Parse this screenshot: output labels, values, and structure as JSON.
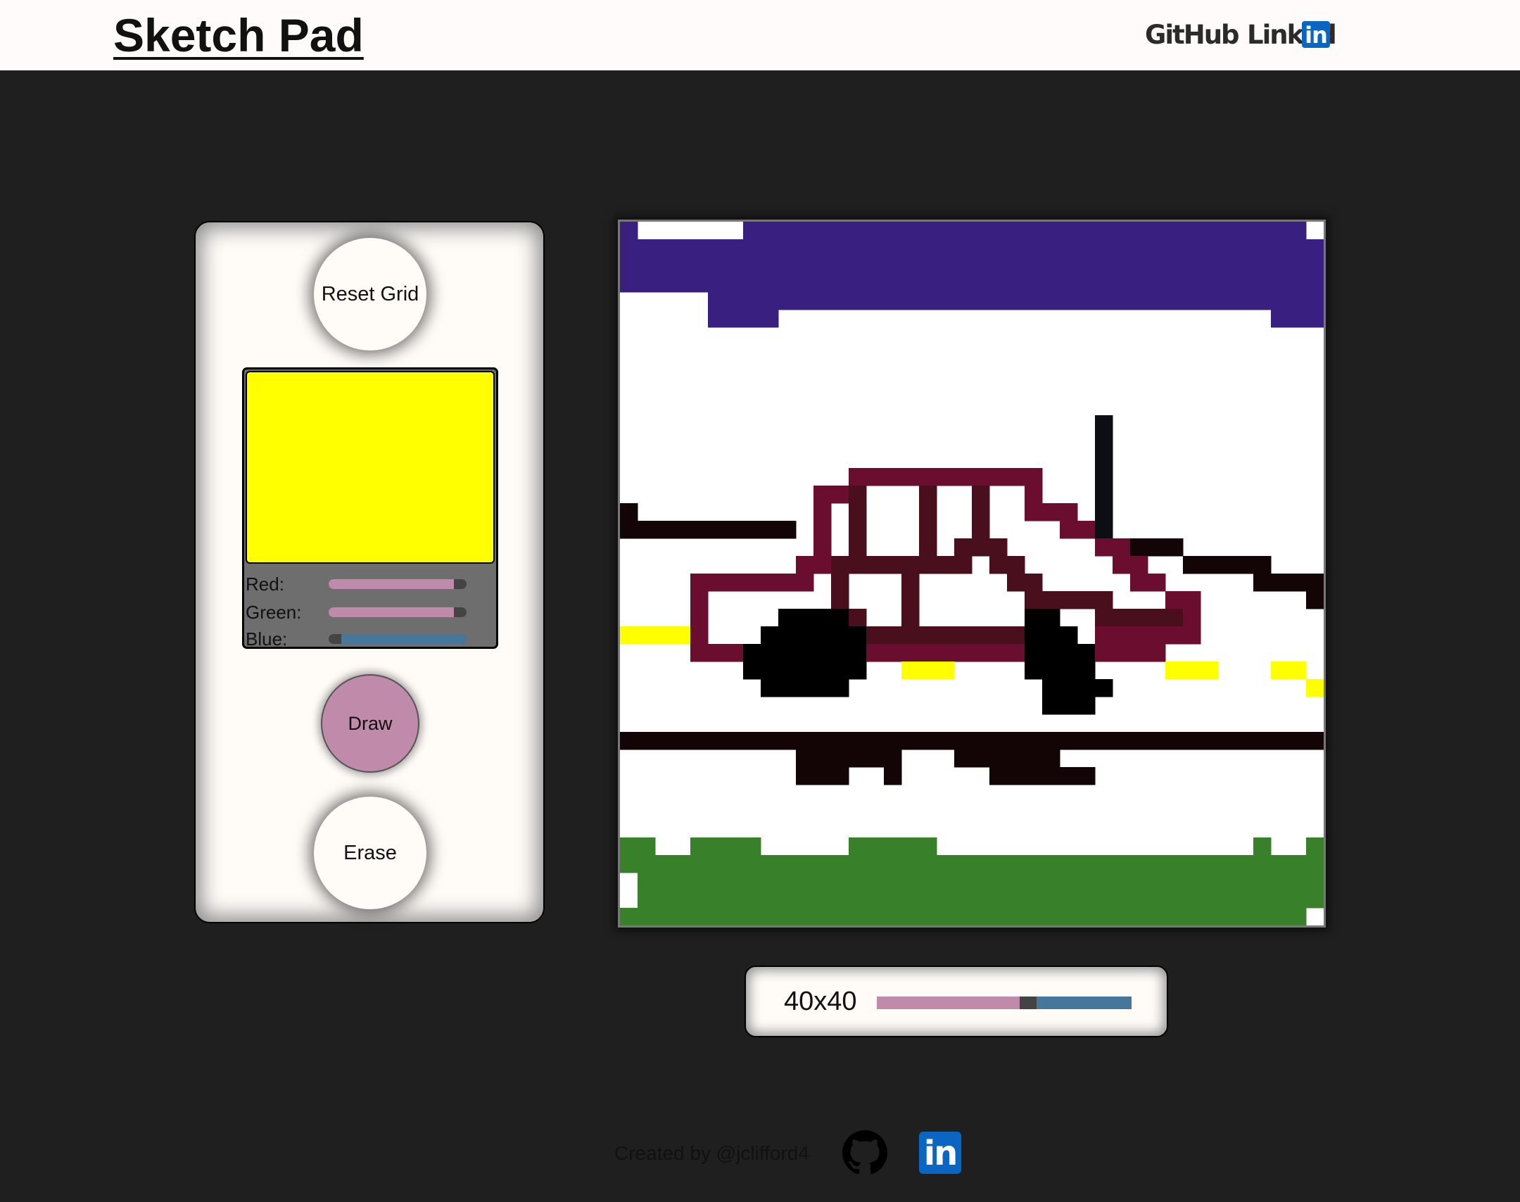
{
  "header": {
    "title": "Sketch Pad",
    "github_label": "GitHub",
    "linkedin_label": "Linked",
    "linkedin_badge": "in"
  },
  "controls": {
    "reset_label": "Reset Grid",
    "draw_label": "Draw",
    "erase_label": "Erase",
    "current_color": "#ffff00",
    "sliders": {
      "red": {
        "label": "Red:",
        "value": 255,
        "max": 255
      },
      "green": {
        "label": "Green:",
        "value": 255,
        "max": 255
      },
      "blue": {
        "label": "Blue:",
        "value": 0,
        "max": 255
      }
    },
    "active_mode": "draw"
  },
  "grid": {
    "size_label": "40x40",
    "size": 40,
    "size_fraction": 0.6,
    "colors": {
      "W": "#ffffff",
      "P": "#381f80",
      "M": "#6a0d2f",
      "D": "#4a0f1c",
      "B": "#130405",
      "K": "#000000",
      "N": "#0c0e14",
      "Y": "#ffff00",
      "G": "#38802a"
    },
    "pixels": [
      "PWWWWWWPPPPPPPPPPPPPPPPPPPPPPPPPPPPPPPPW",
      "PPPPPPPPPPPPPPPPPPPPPPPPPPPPPPPPPPPPPPPP",
      "PPPPPPPPPPPPPPPPPPPPPPPPPPPPPPPPPPPPPPPP",
      "PPPPPPPPPPPPPPPPPPPPPPPPPPPPPPPPPPPPPPPP",
      "WWWWWPPPPPPPPPPPPPPPPPPPPPPPPPPPPPPPPPPP",
      "WWWWWPPPPWWWWWWWWWWWWWWWWWWWWWWWWWWWWPPP",
      "WWWWWWWWWWWWWWWWWWWWWWWWWWWWWWWWWWWWWWWW",
      "WWWWWWWWWWWWWWWWWWWWWWWWWWWWWWWWWWWWWWWW",
      "WWWWWWWWWWWWWWWWWWWWWWWWWWWWWWWWWWWWWWWW",
      "WWWWWWWWWWWWWWWWWWWWWWWWWWWWWWWWWWWWWWWW",
      "WWWWWWWWWWWWWWWWWWWWWWWWWWWWWWWWWWWWWWWW",
      "WWWWWWWWWWWWWWWWWWWWWWWWWWWNWWWWWWWWWWWW",
      "WWWWWWWWWWWWWWWWWWWWWWWWWWWNWWWWWWWWWWWW",
      "WWWWWWWWWWWWWWWWWWWWWWWWWWWNWWWWWWWWWWWW",
      "WWWWWWWWWWWWWMMMMMMMMMMMWWWNWWWWWWWWWWWW",
      "WWWWWWWWWWWMMDWWWDWWDWWMWWWNWWWWWWWWWWWW",
      "BWWWWWWWWWWMWDWWWDWWDWWMMMWNWWWWWWWWWWWW",
      "BBBBBBBBBBWMWDWWWDWWDWWWWMMNWWWWWWWWWWWW",
      "WWWWWWWWWWWMWDWWWDWDDDWWWWWMMBBBWWWWWWWW",
      "WWWWWWWWWWMMDDDDDDDDWDDWWWWWMMWWBBBBBWWW",
      "WWWWMMMMMMMWDWWWDWWWWWDDWWWWWMMWWWWWBBBB",
      "WWWWMWWWWWWWDWWWDWWWWWWDDDDDWWWMMWWWWWWB",
      "WWWWMWWWWKKKKDWWDWWWWWWKKWWDDDDDMWWWWWWW",
      "YYYYMWWWKKKKKKDDDDDDDDDKKKWMMMMMMWWWWWWW",
      "WWWWMMMKKKKKKKMMMMMMMMMKKKKMMMMWWWWWWWWW",
      "WWWWWWWKKKKKKKWWYYYWWWWKKKKWWWWYYYWWWYYW",
      "WWWWWWWWKKKKKWWWWWWWWWWWKKKKWWWWWWWWWWWY",
      "WWWWWWWWWWWWWWWWWWWWWWWWKKKWWWWWWWWWWWWW",
      "WWWWWWWWWWWWWWWWWWWWWWWWWWWWWWWWWWWWWWWW",
      "BBBBBBBBBBBBBBBBBBBBBBBBBBBBBBBBBBBBBBBB",
      "WWWWWWWWWWBBBBBBWWWBBBBBBWWWWWWWWWWWWWWW",
      "WWWWWWWWWWBBBWWBWWWWWBBBBBBWWWWWWWWWWWWW",
      "WWWWWWWWWWWWWWWWWWWWWWWWWWWWWWWWWWWWWWWW",
      "WWWWWWWWWWWWWWWWWWWWWWWWWWWWWWWWWWWWWWWW",
      "WWWWWWWWWWWWWWWWWWWWWWWWWWWWWWWWWWWWWWWW",
      "GGWWGGGGWWWWWGGGGGWWWWWWWWWWWWWWWWWWGWWG",
      "GGGGGGGGGGGGGGGGGGGGGGGGGGGGGGGGGGGGGGGG",
      "WGGGGGGGGGGGGGGGGGGGGGGGGGGGGGGGGGGGGGGG",
      "WGGGGGGGGGGGGGGGGGGGGGGGGGGGGGGGGGGGGGGG",
      "GGGGGGGGGGGGGGGGGGGGGGGGGGGGGGGGGGGGGGGW"
    ]
  },
  "footer": {
    "credit": "Created by @jclifford4",
    "linkedin_badge": "in"
  },
  "icons": {
    "github": "github-icon",
    "linkedin": "linkedin-icon"
  }
}
